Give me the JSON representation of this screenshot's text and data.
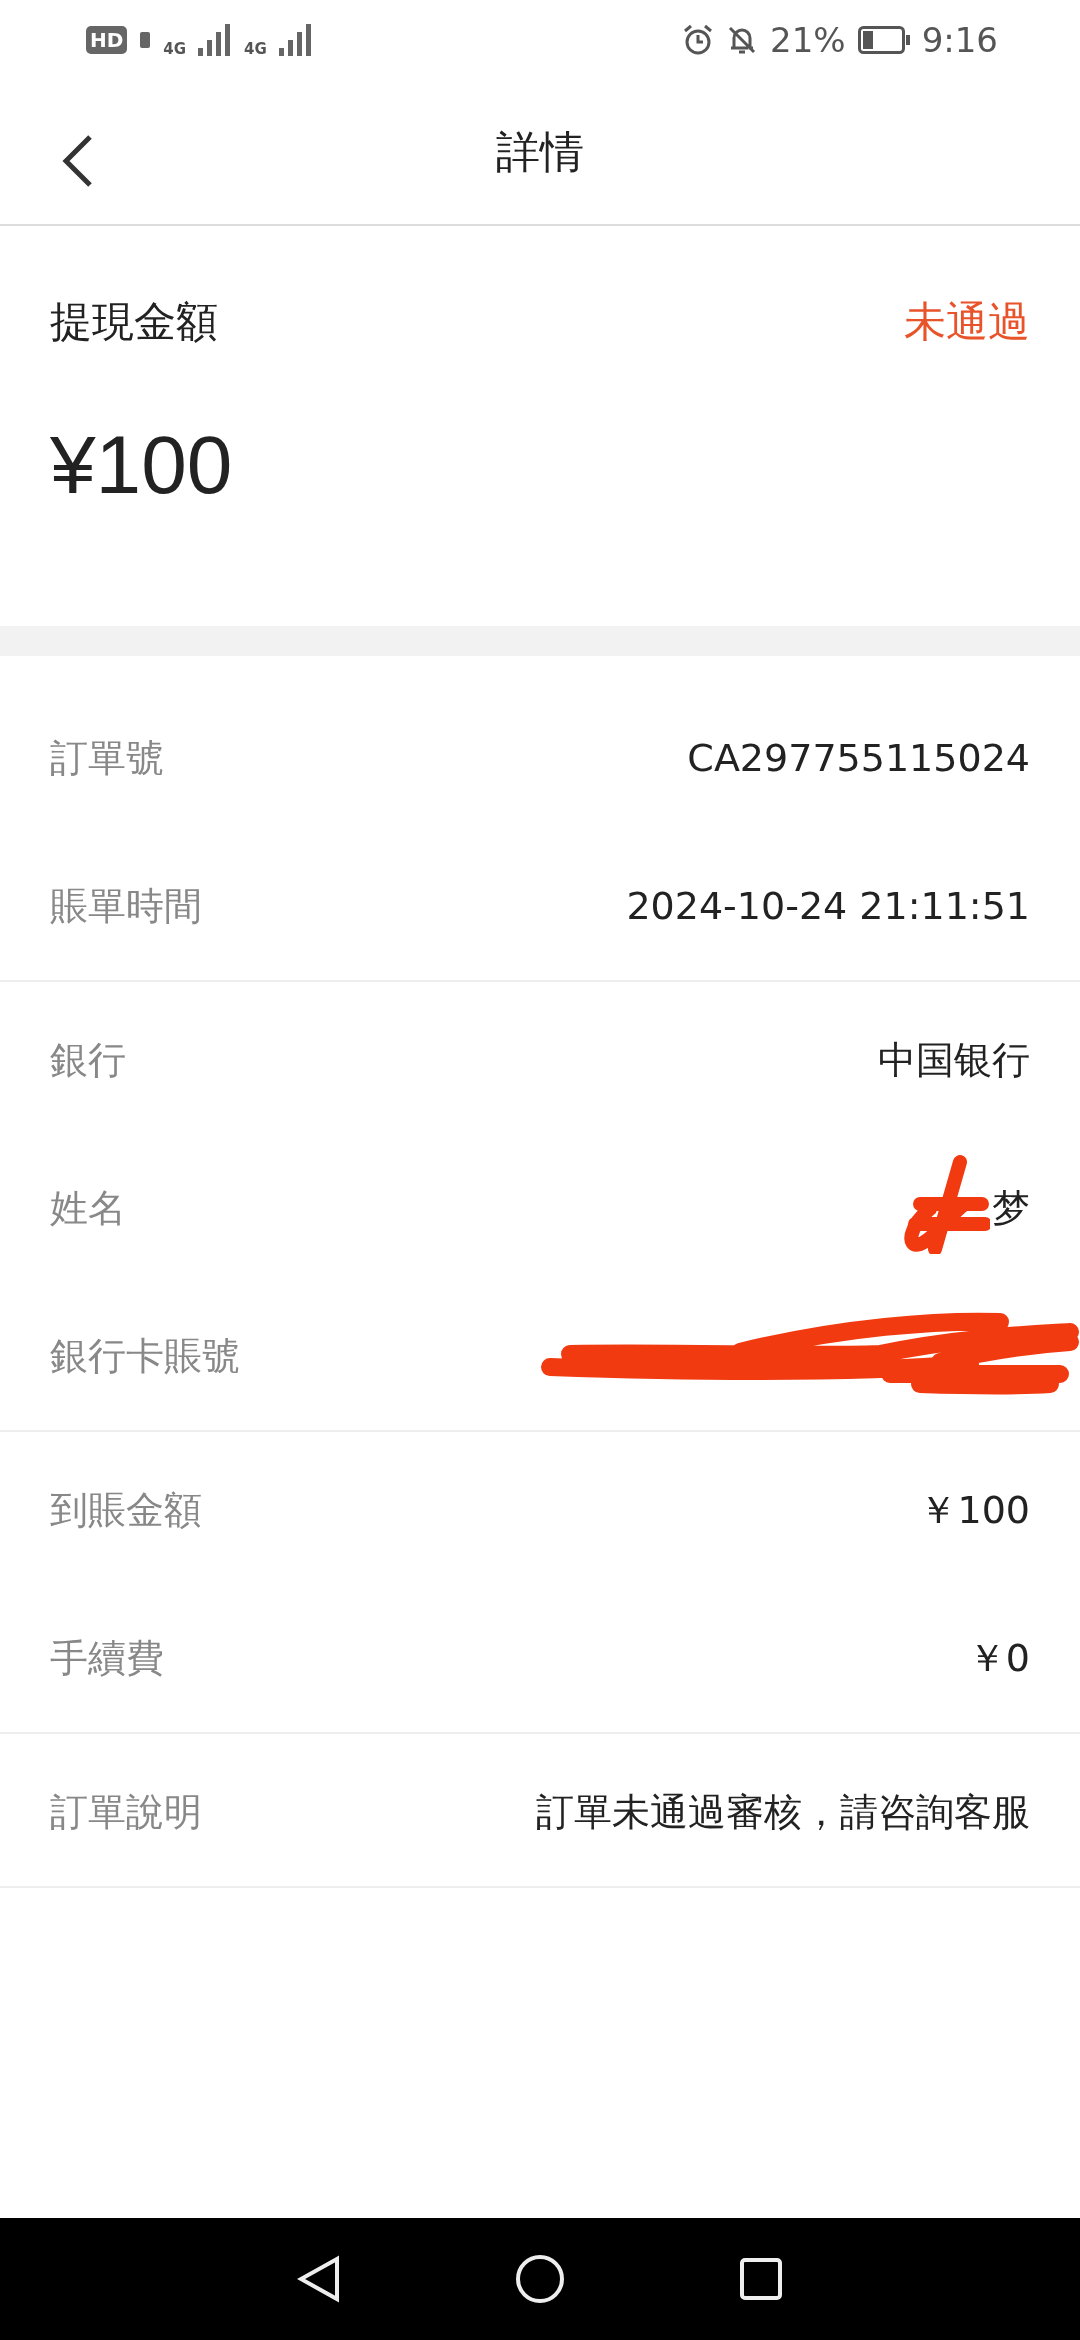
{
  "status_bar": {
    "hd": "HD",
    "network_1": "4G",
    "network_2": "4G",
    "battery_text": "21%",
    "time": "9:16"
  },
  "header": {
    "title": "詳情"
  },
  "summary": {
    "label": "提現金額",
    "status": "未通過",
    "amount": "¥100"
  },
  "groups": [
    {
      "rows": [
        {
          "label": "訂單號",
          "value": "CA297755115024"
        },
        {
          "label": "賬單時間",
          "value": "2024-10-24 21:11:51"
        }
      ]
    },
    {
      "rows": [
        {
          "label": "銀行",
          "value": "中国银行"
        },
        {
          "label": "姓名",
          "value": "梦",
          "redacted": true
        },
        {
          "label": "銀行卡賬號",
          "redacted": true
        }
      ]
    },
    {
      "rows": [
        {
          "label": "到賬金額",
          "value": "￥100"
        },
        {
          "label": "手續費",
          "value": "￥0"
        }
      ]
    },
    {
      "rows": [
        {
          "label": "訂單說明",
          "value": "訂單未通過審核，請咨詢客服"
        }
      ]
    }
  ]
}
